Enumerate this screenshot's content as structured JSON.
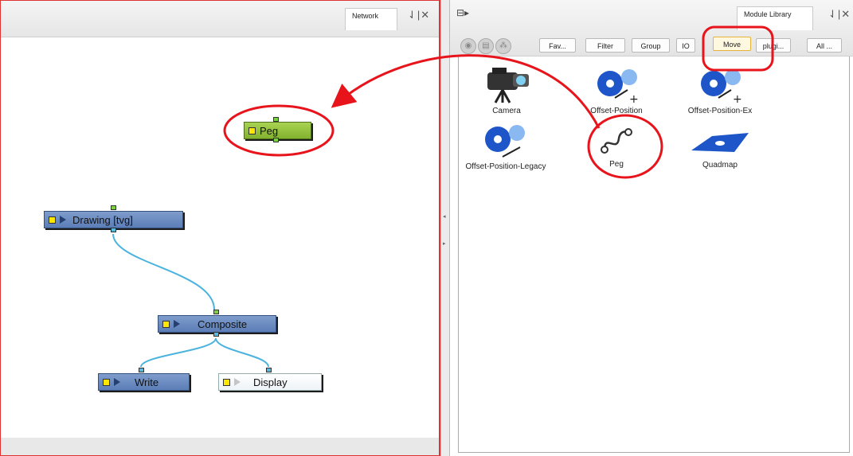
{
  "network_panel": {
    "tab_label": "Network",
    "pin_close": "⇃|✕",
    "nodes": {
      "peg": "Peg",
      "drawing": "Drawing [tvg]",
      "composite": "Composite",
      "write": "Write",
      "display": "Display"
    }
  },
  "library_panel": {
    "toolbar_icon": "⊟▸",
    "tab_label": "Module Library",
    "pin_close": "⇃|✕",
    "view_buttons": [
      "globe",
      "list",
      "tree"
    ],
    "category_tabs": [
      "Fav...",
      "Filter",
      "Group",
      "IO",
      "Move",
      "plugi...",
      "All ..."
    ],
    "active_tab": "Move",
    "modules": [
      {
        "label": "Camera",
        "icon": "camera-icon"
      },
      {
        "label": "Offset-Position",
        "icon": "offset-position-icon"
      },
      {
        "label": "Offset-Position-Ex",
        "icon": "offset-position-ex-icon"
      },
      {
        "label": "Offset-Position-Legacy",
        "icon": "offset-position-legacy-icon"
      },
      {
        "label": "Peg",
        "icon": "peg-icon"
      },
      {
        "label": "Quadmap",
        "icon": "quadmap-icon"
      }
    ]
  },
  "colors": {
    "annotation_red": "#e8141c",
    "node_blue": "#6d8fc4",
    "peg_green": "#94c43e",
    "connection_blue": "#4bb3dd"
  }
}
